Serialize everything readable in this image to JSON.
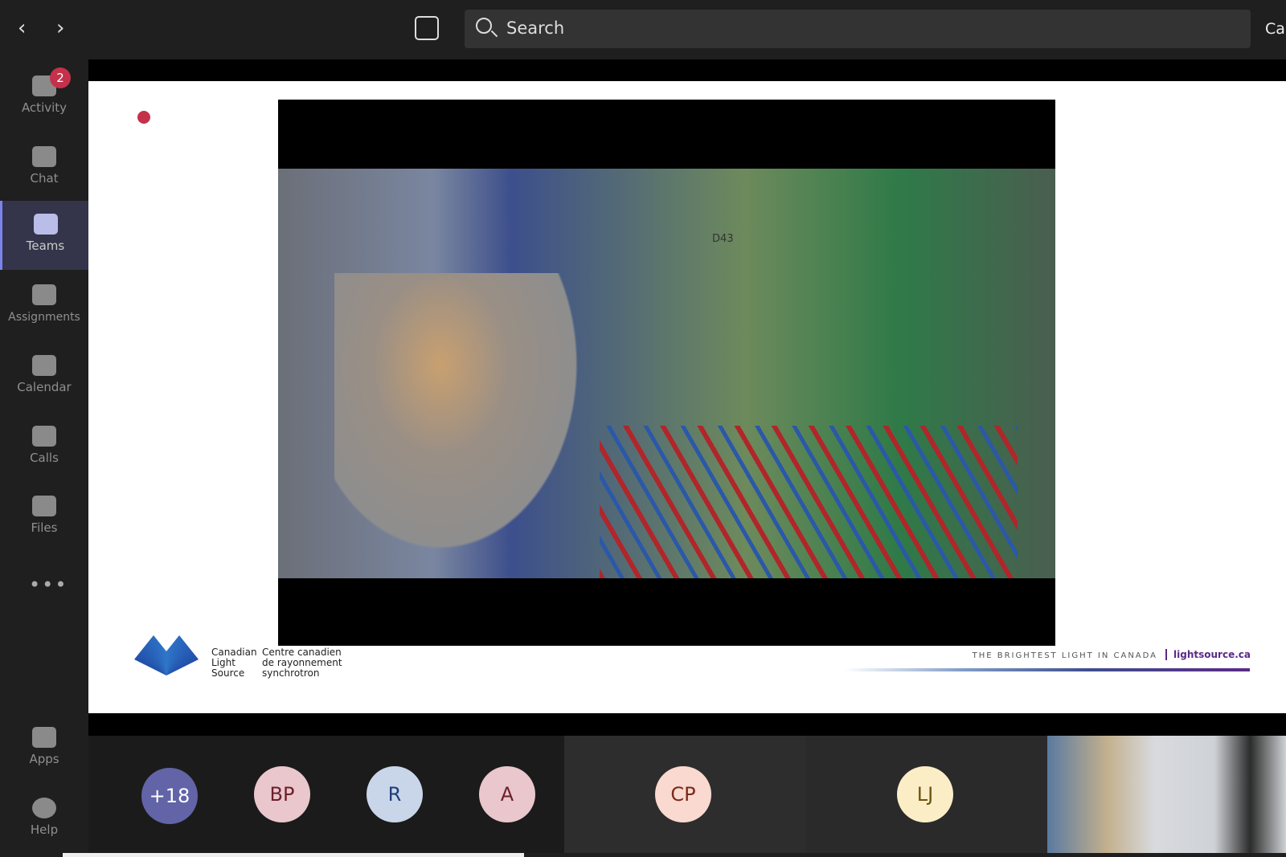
{
  "topbar": {
    "back": "‹",
    "forward": "›",
    "search_placeholder": "Search",
    "truncated_text": "Ca"
  },
  "sidebar": {
    "items": [
      {
        "label": "Activity",
        "icon": "bell-icon",
        "badge": "2"
      },
      {
        "label": "Chat",
        "icon": "chat-icon"
      },
      {
        "label": "Teams",
        "icon": "teams-icon",
        "active": true
      },
      {
        "label": "Assignments",
        "icon": "assignments-icon"
      },
      {
        "label": "Calendar",
        "icon": "calendar-icon"
      },
      {
        "label": "Calls",
        "icon": "phone-icon"
      },
      {
        "label": "Files",
        "icon": "files-icon"
      },
      {
        "label": "Apps",
        "icon": "apps-icon"
      },
      {
        "label": "Help",
        "icon": "help-icon"
      }
    ],
    "more": "•••"
  },
  "slide": {
    "logo_en": [
      "Canadian",
      "Light",
      "Source"
    ],
    "logo_fr": [
      "Centre canadien",
      "de rayonnement",
      "synchrotron"
    ],
    "tagline": "THE BRIGHTEST LIGHT IN CANADA",
    "url": "lightsource.ca",
    "photo_sign": "D43"
  },
  "participants": [
    {
      "initials": "+18",
      "bg": "#6264a7",
      "fg": "#ffffff"
    },
    {
      "initials": "BP",
      "bg": "#e9c7cd",
      "fg": "#6e1f2b"
    },
    {
      "initials": "R",
      "bg": "#c9d6ea",
      "fg": "#1f3f78"
    },
    {
      "initials": "A",
      "bg": "#e9c7cd",
      "fg": "#6e1f2b"
    },
    {
      "initials": "CP",
      "bg": "#f9d9d0",
      "fg": "#7a2a1a"
    },
    {
      "initials": "LJ",
      "bg": "#fbedc6",
      "fg": "#6b5310"
    }
  ],
  "colors": {
    "accent": "#6264a7",
    "badge": "#c4314b"
  }
}
